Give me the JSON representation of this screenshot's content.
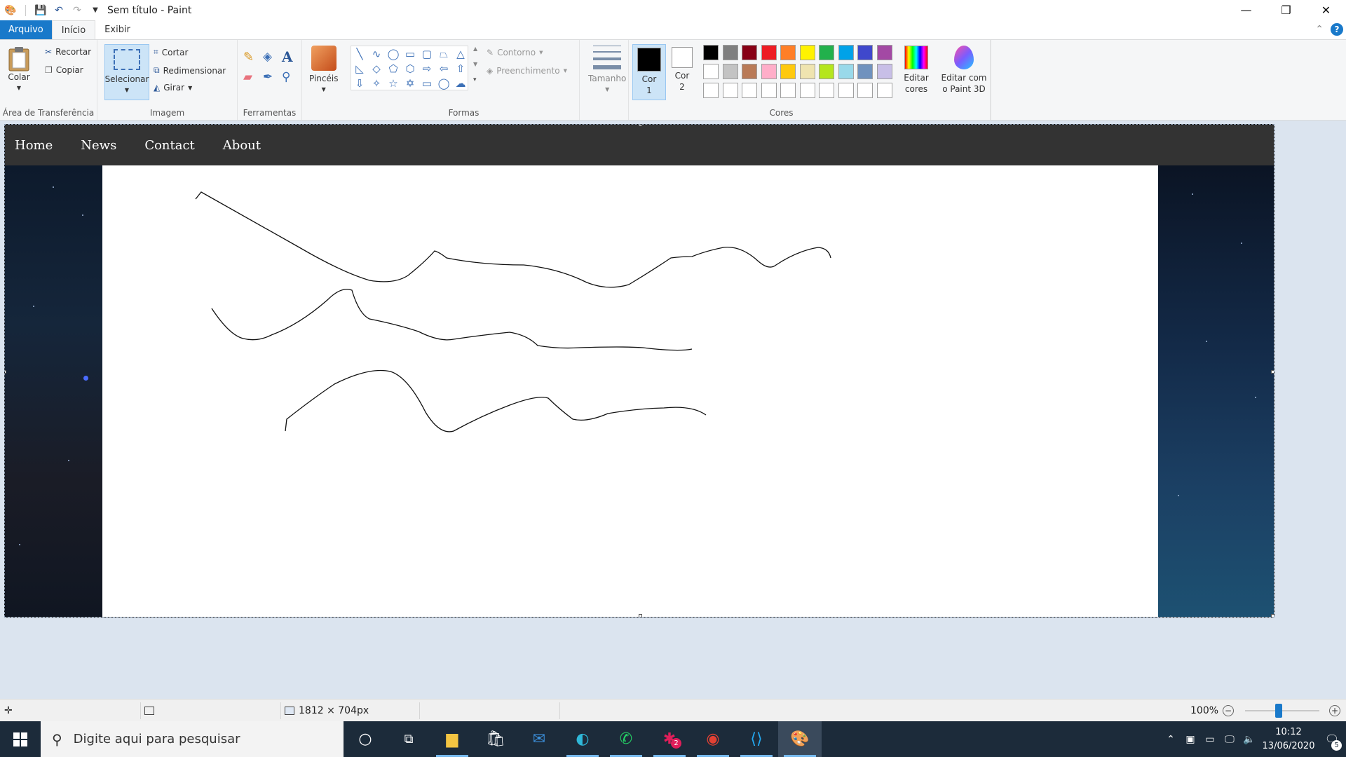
{
  "window": {
    "title": "Sem título - Paint",
    "minimize": "—",
    "maximize": "❐",
    "close": "✕"
  },
  "tabs": [
    "Arquivo",
    "Início",
    "Exibir"
  ],
  "ribbon": {
    "clipboard": {
      "label": "Área de Transferência",
      "paste": "Colar",
      "cut": "Recortar",
      "copy": "Copiar"
    },
    "image": {
      "label": "Imagem",
      "select": "Selecionar",
      "crop": "Cortar",
      "resize": "Redimensionar",
      "rotate": "Girar"
    },
    "tools": {
      "label": "Ferramentas"
    },
    "brushes": {
      "label": "Pincéis"
    },
    "shapes": {
      "label": "Formas",
      "outline": "Contorno",
      "fill": "Preenchimento"
    },
    "size": {
      "label": "Tamanho"
    },
    "colors": {
      "label": "Cores",
      "color1_line1": "Cor",
      "color1_line2": "1",
      "color2_line1": "Cor",
      "color2_line2": "2",
      "edit_line1": "Editar",
      "edit_line2": "cores",
      "paint3d_line1": "Editar com",
      "paint3d_line2": "o Paint 3D",
      "palette": [
        "#000000",
        "#7f7f7f",
        "#880015",
        "#ed1c24",
        "#ff7f27",
        "#fff200",
        "#22b14c",
        "#00a2e8",
        "#3f48cc",
        "#a349a4",
        "#ffffff",
        "#c3c3c3",
        "#b97a57",
        "#ffaec9",
        "#ffc90e",
        "#efe4b0",
        "#b5e61d",
        "#99d9ea",
        "#7092be",
        "#c8bfe7",
        "#ffffff",
        "#ffffff",
        "#ffffff",
        "#ffffff",
        "#ffffff",
        "#ffffff",
        "#ffffff",
        "#ffffff",
        "#ffffff",
        "#ffffff"
      ],
      "color1": "#000000",
      "color2": "#ffffff"
    }
  },
  "canvas_content": {
    "nav": [
      "Home",
      "News",
      "Contact",
      "About"
    ]
  },
  "status": {
    "dimensions": "1812 × 704px",
    "zoom": "100%",
    "zoom_fraction": 0.45
  },
  "taskbar": {
    "search_placeholder": "Digite aqui para pesquisar",
    "time": "10:12",
    "date": "13/06/2020",
    "notifications": "5",
    "slack_badge": "2"
  }
}
